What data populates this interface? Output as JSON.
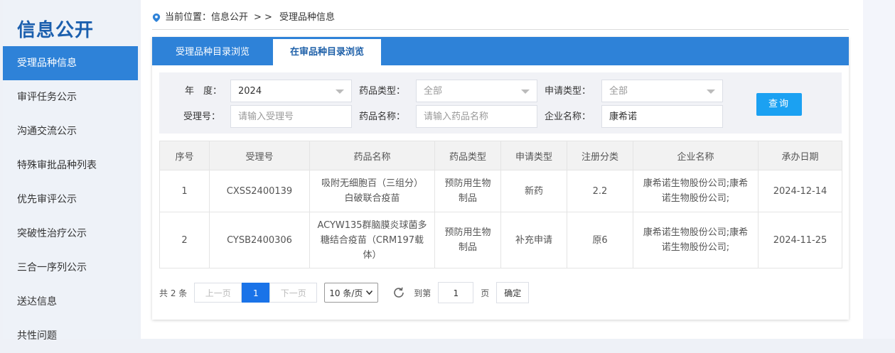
{
  "sidebar": {
    "title": "信息公开",
    "items": [
      "受理品种信息",
      "审评任务公示",
      "沟通交流公示",
      "特殊审批品种列表",
      "优先审评公示",
      "突破性治疗公示",
      "三合一序列公示",
      "送达信息",
      "共性问题"
    ]
  },
  "breadcrumb": {
    "label": "当前位置：信息公开",
    "sep": "> >",
    "current": "受理品种信息"
  },
  "tabs": [
    "受理品种目录浏览",
    "在审品种目录浏览"
  ],
  "filters": {
    "year_label": "年　度：",
    "year_value": "2024",
    "drug_type_label": "药品类型：",
    "drug_type_value": "全部",
    "apply_type_label": "申请类型：",
    "apply_type_value": "全部",
    "accept_no_label": "受理号：",
    "accept_no_placeholder": "请输入受理号",
    "drug_name_label": "药品名称：",
    "drug_name_placeholder": "请输入药品名称",
    "company_label": "企业名称：",
    "company_value": "康希诺",
    "query_button": "查询"
  },
  "table": {
    "headers": [
      "序号",
      "受理号",
      "药品名称",
      "药品类型",
      "申请类型",
      "注册分类",
      "企业名称",
      "承办日期"
    ],
    "rows": [
      [
        "1",
        "CXSS2400139",
        "吸附无细胞百（三组分）白破联合疫苗",
        "预防用生物制品",
        "新药",
        "2.2",
        "康希诺生物股份公司;康希诺生物股份公司;",
        "2024-12-14"
      ],
      [
        "2",
        "CYSB2400306",
        "ACYW135群脑膜炎球菌多糖结合疫苗（CRM197载体）",
        "预防用生物制品",
        "补充申请",
        "原6",
        "康希诺生物股份公司;康希诺生物股份公司;",
        "2024-11-25"
      ]
    ]
  },
  "pager": {
    "total": "共 2 条",
    "prev": "上一页",
    "current": "1",
    "next": "下一页",
    "page_size": "10 条/页",
    "goto_label": "到第",
    "goto_value": "1",
    "page_unit": "页",
    "confirm": "确定"
  },
  "colors": {
    "accent": "#2e82d8",
    "title": "#1b5fae",
    "query": "#1ba1f2"
  },
  "icons": {
    "location": "location-pin-icon",
    "refresh": "refresh-icon"
  }
}
